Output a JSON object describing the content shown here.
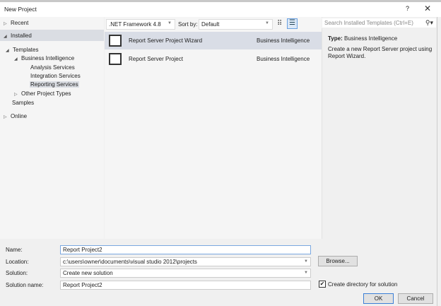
{
  "window": {
    "title": "New Project",
    "help": "?",
    "close": "✕"
  },
  "tree": {
    "recent": "Recent",
    "installed": "Installed",
    "templates": "Templates",
    "bi": "Business Intelligence",
    "analysis": "Analysis Services",
    "integration": "Integration Services",
    "reporting": "Reporting Services",
    "other": "Other Project Types",
    "samples": "Samples",
    "online": "Online"
  },
  "toolbar": {
    "framework": ".NET Framework 4.8",
    "sort_label": "Sort by:",
    "sort_value": "Default",
    "search_placeholder": "Search Installed Templates (Ctrl+E)"
  },
  "templates": [
    {
      "name": "Report Server Project Wizard",
      "category": "Business Intelligence"
    },
    {
      "name": "Report Server Project",
      "category": "Business Intelligence"
    }
  ],
  "details": {
    "type_label": "Type:",
    "type_value": "Business Intelligence",
    "description": "Create a new Report Server project using Report Wizard."
  },
  "form": {
    "name_label": "Name:",
    "name_value": "Report Project2",
    "location_label": "Location:",
    "location_value": "c:\\users\\owner\\documents\\visual studio 2012\\projects",
    "solution_label": "Solution:",
    "solution_value": "Create new solution",
    "solution_name_label": "Solution name:",
    "solution_name_value": "Report Project2",
    "browse": "Browse...",
    "create_dir": "Create directory for solution",
    "create_dir_checked": true,
    "ok": "OK",
    "cancel": "Cancel"
  }
}
